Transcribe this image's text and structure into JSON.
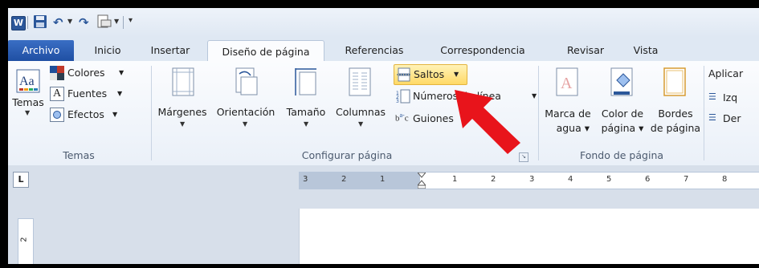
{
  "tabs": {
    "file": "Archivo",
    "items": [
      "Inicio",
      "Insertar",
      "Diseño de página",
      "Referencias",
      "Correspondencia",
      "Revisar",
      "Vista"
    ],
    "active": "Diseño de página"
  },
  "temas": {
    "temas_label": "Temas",
    "colores": "Colores",
    "fuentes": "Fuentes",
    "efectos": "Efectos",
    "group": "Temas"
  },
  "configurar": {
    "margenes": "Márgenes",
    "orientacion": "Orientación",
    "tamano": "Tamaño",
    "columnas": "Columnas",
    "saltos": "Saltos",
    "numeros_linea": "Números de línea",
    "guiones": "Guiones",
    "group": "Configurar página"
  },
  "fondo": {
    "marca_1": "Marca de",
    "marca_2": "agua",
    "color_1": "Color de",
    "color_2": "página",
    "bordes_1": "Bordes",
    "bordes_2": "de página",
    "group": "Fondo de página"
  },
  "parrafo": {
    "aplicar": "Aplicar",
    "izq": "Izq",
    "der": "Der"
  },
  "ruler": {
    "corner": "L",
    "left_numbers": [
      "3",
      "2",
      "1"
    ],
    "right_numbers": [
      "1",
      "2",
      "3",
      "4",
      "5",
      "6",
      "7",
      "8"
    ],
    "vertical": "2"
  },
  "colors": {
    "accent": "#2b579a",
    "file_tab": "#2a5db0",
    "highlight": "#ffe082",
    "pointer": "#e8141b"
  }
}
